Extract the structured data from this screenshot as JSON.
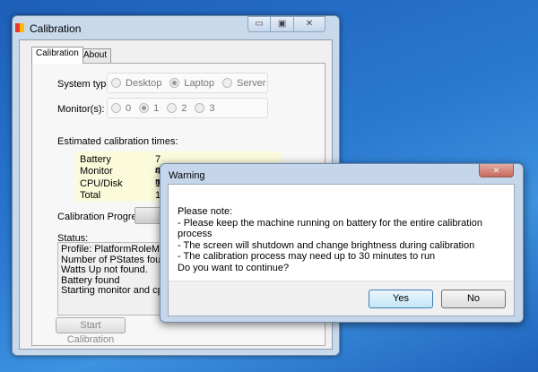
{
  "window": {
    "title": "Calibration",
    "controls": [
      "▭",
      "▣",
      "✕"
    ]
  },
  "tabs": [
    {
      "label": "Calibration"
    },
    {
      "label": "About"
    }
  ],
  "system_type": {
    "label": "System type:",
    "options": [
      "Desktop",
      "Laptop",
      "Server"
    ],
    "selected": "Laptop"
  },
  "monitors": {
    "label": "Monitor(s):",
    "options": [
      "0",
      "1",
      "2",
      "3"
    ],
    "selected": "1"
  },
  "estimates": {
    "label": "Estimated calibration times:",
    "rows": [
      {
        "name": "Battery",
        "value": "7 minutes"
      },
      {
        "name": "Monitor",
        "value": "4 m"
      },
      {
        "name": "CPU/Disk",
        "value": "13"
      },
      {
        "name": "Total",
        "value": "18"
      }
    ]
  },
  "progress": {
    "label": "Calibration Progress"
  },
  "status": {
    "label": "Status:",
    "lines": [
      "Profile: PlatformRoleMobile",
      "Number of PStates found:4",
      "Watts Up not found.",
      "Battery found",
      "Starting monitor and cpu calib"
    ]
  },
  "start_button": "Start Calibration",
  "dialog": {
    "title": "Warning",
    "close": "✕",
    "lines": [
      "Please note:",
      "- Please keep the machine running on battery for the entire calibration process",
      "- The screen will shutdown and change brightness during calibration",
      "- The calibration process may need up to 30 minutes to run",
      "Do you want to continue?"
    ],
    "yes": "Yes",
    "no": "No"
  }
}
